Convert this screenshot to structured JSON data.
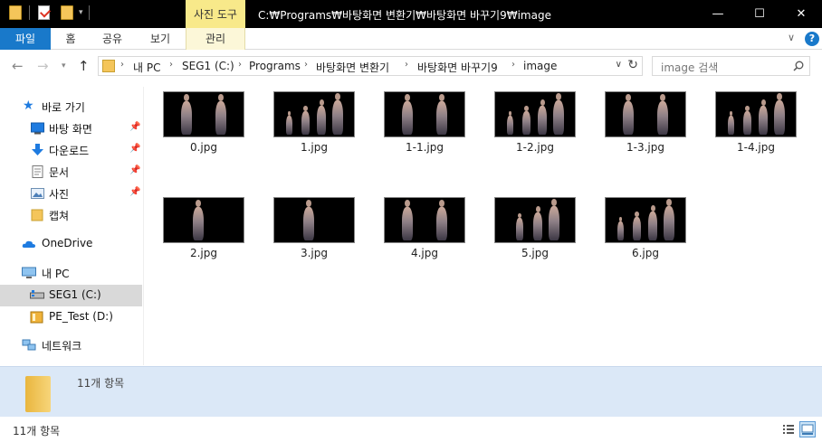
{
  "titlebar": {
    "context_tab": "사진 도구",
    "path_title": "C:₩Programs₩바탕화면 변환기₩바탕화면 바꾸기9₩image",
    "minimize": "—",
    "maximize": "☐",
    "close": "✕"
  },
  "ribbon": {
    "tabs": [
      "파일",
      "홈",
      "공유",
      "보기",
      "관리"
    ],
    "expand_chevron": "∨",
    "help": "?"
  },
  "address": {
    "crumbs": [
      "내 PC",
      "SEG1 (C:)",
      "Programs",
      "바탕화면 변환기",
      "바탕화면 바꾸기9",
      "image"
    ],
    "separator": "›",
    "search_placeholder": "image 검색"
  },
  "nav": {
    "quick_access": "바로 가기",
    "pinned": [
      {
        "label": "바탕 화면",
        "icon": "desktop-icon"
      },
      {
        "label": "다운로드",
        "icon": "download-icon"
      },
      {
        "label": "문서",
        "icon": "document-icon"
      },
      {
        "label": "사진",
        "icon": "pictures-icon"
      }
    ],
    "captures": "캡쳐",
    "onedrive": "OneDrive",
    "this_pc": "내 PC",
    "drives": [
      {
        "label": "SEG1 (C:)",
        "selected": true
      },
      {
        "label": "PE_Test (D:)",
        "selected": false
      }
    ],
    "network": "네트워크"
  },
  "files": [
    {
      "name": "0.jpg",
      "figures": 2
    },
    {
      "name": "1.jpg",
      "figures": 4
    },
    {
      "name": "1-1.jpg",
      "figures": 2
    },
    {
      "name": "1-2.jpg",
      "figures": 4
    },
    {
      "name": "1-3.jpg",
      "figures": 2
    },
    {
      "name": "1-4.jpg",
      "figures": 4
    },
    {
      "name": "2.jpg",
      "figures": 1
    },
    {
      "name": "3.jpg",
      "figures": 1
    },
    {
      "name": "4.jpg",
      "figures": 2
    },
    {
      "name": "5.jpg",
      "figures": 3
    },
    {
      "name": "6.jpg",
      "figures": 4
    }
  ],
  "details": {
    "count_text": "11개 항목"
  },
  "status": {
    "count_text": "11개 항목"
  },
  "colors": {
    "accent": "#1979ca",
    "context_tab": "#f8e98a",
    "details_bg": "#dbe8f7",
    "selected_bg": "#d9d9d9",
    "folder": "#f4c55a"
  }
}
